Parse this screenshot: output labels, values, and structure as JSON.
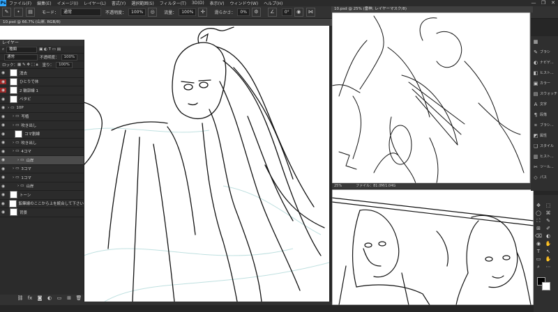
{
  "menubar": {
    "logo": "Ps",
    "items": [
      "ファイル(F)",
      "編集(E)",
      "イメージ(I)",
      "レイヤー(L)",
      "書式(Y)",
      "選択範囲(S)",
      "フィルター(T)",
      "3D(D)",
      "表示(V)",
      "ウィンドウ(W)",
      "ヘルプ(H)"
    ],
    "controls": [
      "—",
      "❐",
      "✕"
    ]
  },
  "options": {
    "mode_label": "モード：",
    "mode_value": "通常",
    "opacity_label": "不透明度：",
    "opacity_value": "100%",
    "flow_label": "流量：",
    "flow_value": "100%",
    "smoothing_label": "滑らかさ：",
    "smoothing_value": "0%",
    "angle_value": "0°"
  },
  "docs": {
    "main_tab": "10.psd @ 66.7% (山岸, RGB/8)",
    "float1_tab": "10.psd @ 25% (雷神, レイヤーマスク/8)",
    "float1_status": "25%",
    "float1_file": "ファイル：81.0M/1.04G"
  },
  "layers": {
    "title": "レイヤー",
    "kind_label": "種類",
    "blend_value": "通常",
    "opacity_label": "不透明度：",
    "opacity_value": "100%",
    "lock_label": "ロック：",
    "fill_label": "塗り：",
    "fill_value": "100%",
    "rows": [
      {
        "name": "消去",
        "indent": 0,
        "type": "layer",
        "red": false,
        "sel": false
      },
      {
        "name": "ひとりで休",
        "indent": 0,
        "type": "layer",
        "red": true,
        "sel": false
      },
      {
        "name": "2 輪郭線 1",
        "indent": 0,
        "type": "layer",
        "red": true,
        "sel": false
      },
      {
        "name": "ベタビ",
        "indent": 0,
        "type": "layer",
        "red": false,
        "sel": false
      },
      {
        "name": "10P",
        "indent": 0,
        "type": "group",
        "red": false,
        "sel": false
      },
      {
        "name": "写植",
        "indent": 1,
        "type": "group",
        "red": false,
        "sel": false
      },
      {
        "name": "吹き出し",
        "indent": 1,
        "type": "group",
        "red": false,
        "sel": false
      },
      {
        "name": "コマ割線",
        "indent": 1,
        "type": "layer",
        "red": false,
        "sel": false
      },
      {
        "name": "吹き出し",
        "indent": 1,
        "type": "group",
        "red": false,
        "sel": false
      },
      {
        "name": "4コマ",
        "indent": 1,
        "type": "group",
        "red": false,
        "sel": false
      },
      {
        "name": "山岸",
        "indent": 2,
        "type": "group",
        "red": false,
        "sel": true
      },
      {
        "name": "3コマ",
        "indent": 1,
        "type": "group",
        "red": false,
        "sel": false
      },
      {
        "name": "1コマ",
        "indent": 1,
        "type": "group",
        "red": false,
        "sel": false
      },
      {
        "name": "山岸",
        "indent": 2,
        "type": "group",
        "red": false,
        "sel": false
      },
      {
        "name": "トーン",
        "indent": 0,
        "type": "layer",
        "red": false,
        "sel": false
      },
      {
        "name": "鉛筆線のここから上を統合して下さい",
        "indent": 0,
        "type": "layer",
        "red": false,
        "sel": false
      },
      {
        "name": "背景",
        "indent": 0,
        "type": "layer",
        "red": false,
        "sel": false
      }
    ],
    "footer_icons": [
      "link-icon",
      "fx-icon",
      "mask-icon",
      "adjust-icon",
      "folder-icon",
      "new-layer-icon",
      "trash-icon"
    ]
  },
  "panels": [
    {
      "icon": "▦",
      "label": ""
    },
    {
      "icon": "✎",
      "label": "ブラシ"
    },
    {
      "icon": "◐",
      "label": "ナビゲ..."
    },
    {
      "icon": "◧",
      "label": "ヒスト..."
    },
    {
      "icon": "▣",
      "label": "カラー"
    },
    {
      "icon": "▤",
      "label": "スウォッチ"
    },
    {
      "icon": "A",
      "label": "文字"
    },
    {
      "icon": "¶",
      "label": "段落"
    },
    {
      "icon": "⌗",
      "label": "ブラシ..."
    },
    {
      "icon": "◩",
      "label": "属性"
    },
    {
      "icon": "❏",
      "label": "スタイル"
    },
    {
      "icon": "▥",
      "label": "ヒスト..."
    },
    {
      "icon": "✂",
      "label": "ツール..."
    },
    {
      "icon": "◇",
      "label": "パス"
    }
  ],
  "tools": [
    "✥",
    "⬚",
    "◯",
    "⌘",
    "⛶",
    "✎",
    "⊞",
    "✐",
    "⌫",
    "◐",
    "◉",
    "✋",
    "T",
    "↖",
    "▭",
    "✋",
    "⌕",
    "⋯"
  ]
}
